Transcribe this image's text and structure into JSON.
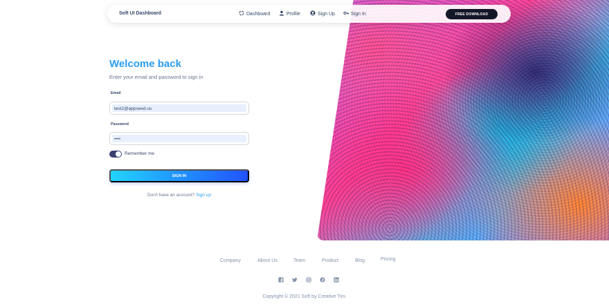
{
  "navbar": {
    "brand": "Soft UI Dashboard",
    "links": {
      "dashboard": "Dashboard",
      "profile": "Profile",
      "signup": "Sign Up",
      "signin": "Sign In"
    },
    "download_label": "FREE DOWNLOAD"
  },
  "form": {
    "title": "Welcome back",
    "subtitle": "Enter your email and password to sign in",
    "email_label": "Email",
    "email_value": "test2@appseed.us",
    "password_label": "Password",
    "password_value": "••••",
    "remember_label": "Remember me",
    "remember_on": true,
    "submit_label": "SIGN IN",
    "signup_prompt": "Don't have an account?",
    "signup_link": "Sign up"
  },
  "footer": {
    "links": [
      "Company",
      "About Us",
      "Team",
      "Product",
      "Blog",
      "Pricing"
    ],
    "social_icons": [
      "facebook-icon",
      "twitter-icon",
      "instagram-icon",
      "pinterest-icon",
      "linkedin-icon"
    ],
    "copyright": "Copyright © 2021 Soft by Creative Tim."
  },
  "colors": {
    "accent": "#2a9df0",
    "dark": "#141727",
    "toggle": "#3a416f",
    "button_gradient": [
      "#21d4fd",
      "#2152ff"
    ]
  }
}
